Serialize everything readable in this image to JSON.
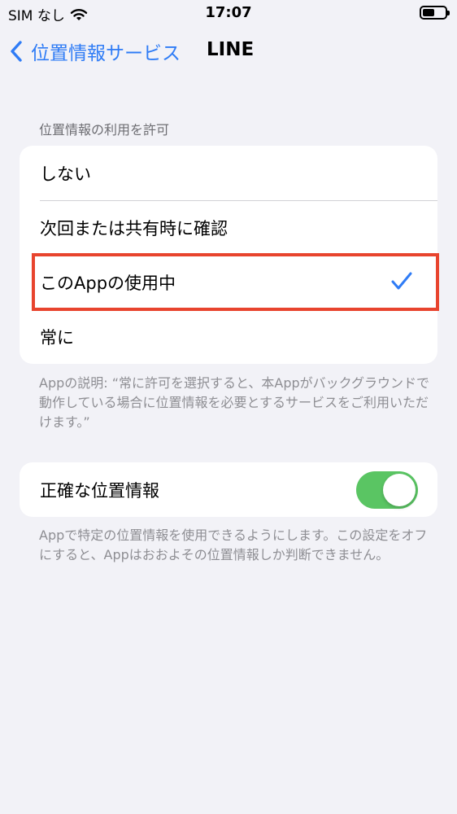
{
  "status_bar": {
    "carrier": "SIM なし",
    "time": "17:07"
  },
  "nav": {
    "back_label": "位置情報サービス",
    "title": "LINE"
  },
  "location_access": {
    "header": "位置情報の利用を許可",
    "options": [
      {
        "label": "しない",
        "selected": false
      },
      {
        "label": "次回または共有時に確認",
        "selected": false
      },
      {
        "label": "このAppの使用中",
        "selected": true
      },
      {
        "label": "常に",
        "selected": false
      }
    ],
    "footer": "Appの説明: “常に許可を選択すると、本Appがバックグラウンドで動作している場合に位置情報を必要とするサービスをご利用いただけます。”"
  },
  "precise_location": {
    "label": "正確な位置情報",
    "enabled": true,
    "footer": "Appで特定の位置情報を使用できるようにします。この設定をオフにすると、Appはおおよその位置情報しか判断できません。"
  },
  "colors": {
    "accent": "#2f7cf6",
    "toggle_on": "#5ac563",
    "highlight_border": "#e8442e"
  }
}
